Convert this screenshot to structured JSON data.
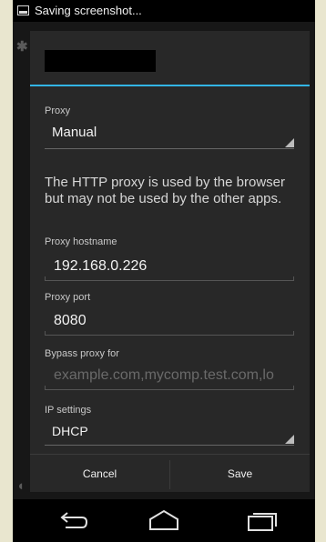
{
  "status_bar": {
    "text": "Saving screenshot...",
    "icon": "screenshot-icon"
  },
  "dialog": {
    "proxy": {
      "label": "Proxy",
      "value": "Manual"
    },
    "info_text": "The HTTP proxy is used by the browser but may not be used by the other apps.",
    "hostname": {
      "label": "Proxy hostname",
      "value": "192.168.0.226"
    },
    "port": {
      "label": "Proxy port",
      "value": "8080"
    },
    "bypass": {
      "label": "Bypass proxy for",
      "placeholder": "example.com,mycomp.test.com,lo"
    },
    "ip_settings": {
      "label": "IP settings",
      "value": "DHCP"
    },
    "buttons": {
      "cancel": "Cancel",
      "save": "Save"
    }
  },
  "colors": {
    "accent": "#33b5e5",
    "dialog_bg": "#282828",
    "page_bg": "#e9e6cf"
  },
  "nav_icons": [
    "back-icon",
    "home-icon",
    "recent-apps-icon"
  ]
}
